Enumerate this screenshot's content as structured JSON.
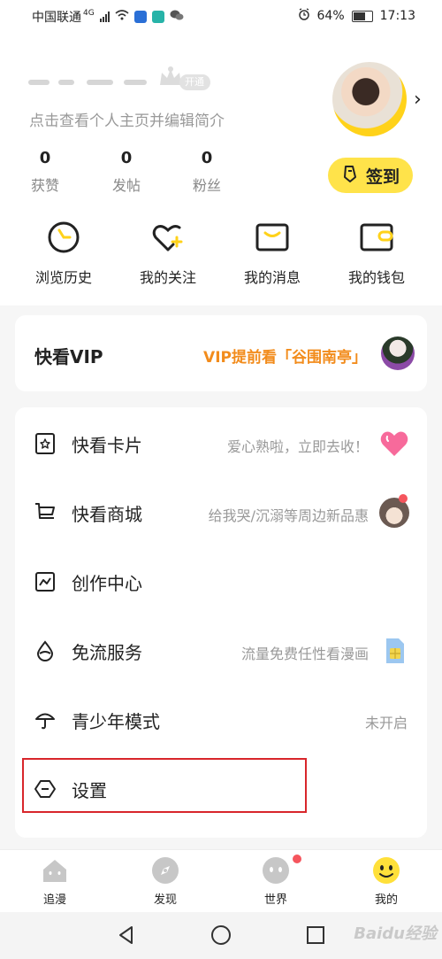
{
  "status_bar": {
    "carrier": "中国联通",
    "network": "4G",
    "battery": "64%",
    "time": "17:13"
  },
  "profile": {
    "open_badge": "开通",
    "edit_hint": "点击查看个人主页并编辑简介",
    "stats": [
      {
        "value": "0",
        "label": "获赞"
      },
      {
        "value": "0",
        "label": "发帖"
      },
      {
        "value": "0",
        "label": "粉丝"
      }
    ],
    "checkin_label": "签到",
    "arrow": "›"
  },
  "quick_actions": [
    {
      "label": "浏览历史",
      "icon": "clock-icon"
    },
    {
      "label": "我的关注",
      "icon": "heart-plus-icon"
    },
    {
      "label": "我的消息",
      "icon": "message-icon"
    },
    {
      "label": "我的钱包",
      "icon": "wallet-icon"
    }
  ],
  "vip": {
    "title": "快看VIP",
    "promo": "VIP提前看「谷围南亭」"
  },
  "menu": [
    {
      "label": "快看卡片",
      "sub": "爱心熟啦，立即去收！",
      "icon": "card-star-icon",
      "thumb": "pink-heart"
    },
    {
      "label": "快看商城",
      "sub": "给我哭/沉溺等周边新品惠",
      "icon": "cart-icon",
      "thumb": "character-avatar"
    },
    {
      "label": "创作中心",
      "sub": "",
      "icon": "chart-icon",
      "thumb": ""
    },
    {
      "label": "免流服务",
      "sub": "流量免费任性看漫画",
      "icon": "drop-icon",
      "thumb": "sim-card"
    },
    {
      "label": "青少年模式",
      "sub": "未开启",
      "icon": "umbrella-icon",
      "thumb": ""
    },
    {
      "label": "设置",
      "sub": "",
      "icon": "settings-icon",
      "thumb": ""
    }
  ],
  "tabs": [
    {
      "label": "追漫",
      "icon": "house-icon"
    },
    {
      "label": "发现",
      "icon": "compass-icon"
    },
    {
      "label": "世界",
      "icon": "world-face-icon"
    },
    {
      "label": "我的",
      "icon": "me-face-icon"
    }
  ],
  "watermark": "Baidu经验",
  "colors": {
    "accent_yellow": "#ffe34a",
    "promo_orange": "#f28c1c",
    "highlight_red": "#d8262b",
    "badge_red": "#f5555d"
  }
}
